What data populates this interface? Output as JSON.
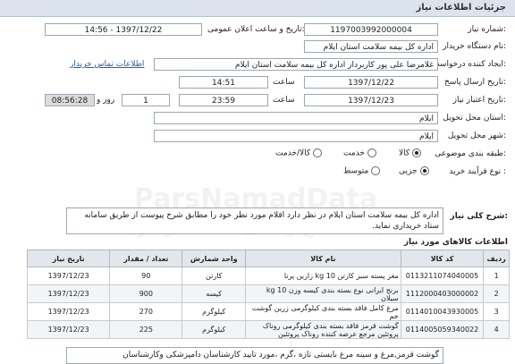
{
  "header": {
    "title": "جزئیات اطلاعات نیاز"
  },
  "form": {
    "need_number_label": "شماره نیاز:",
    "need_number": "1197003992000004",
    "announce_label": "تاریخ و ساعت اعلان عمومی:",
    "announce_value": "1397/12/22 - 14:56",
    "buyer_label": "نام دستگاه خریدار:",
    "buyer": "اداره کل بیمه سلامت استان ایلام",
    "creator_label": "ایجاد کننده درخواست:",
    "creator": "غلامرضا علی پور کاربرداز اداره کل بیمه سلامت استان ایلام",
    "contact_link": "اطلاعات تماس خریدار",
    "send_date_label": "تاریخ ارسال پاسخ:",
    "send_date": "1397/12/22",
    "send_time_label": "ساعت",
    "send_time": "14:51",
    "valid_label": "تاریخ اعتبار نیاز:",
    "valid_date": "1397/12/23",
    "valid_time_label": "ساعت",
    "valid_time": "23:59",
    "days": "1",
    "days_label": "روز و",
    "remaining": "08:56:28",
    "remaining_label": "ساعت باقی مانده",
    "province_label": "استان محل تحویل:",
    "province": "ایلام",
    "city_label": "شهر محل تحویل:",
    "city": "ایلام",
    "category_label": "طبقه بندی موضوعی:",
    "category_options": [
      "کالا",
      "خدمت",
      "کالا/خدمت"
    ],
    "category_selected": "کالا",
    "process_label": "نوع فرآیند خرید :",
    "process_options": [
      "جزیی",
      "متوسط"
    ],
    "process_selected": "جزیی"
  },
  "summary": {
    "label": "شرح کلی نیاز:",
    "text": "اداره کل بیمه سلامت استان ایلام در نظر دارد اقلام مورد نظر خود را مطابق شرح پیوست  از طریق سامانه ستاد خریداری نماید."
  },
  "items": {
    "section_title": "اطلاعات کالاهای مورد نیاز",
    "columns": [
      "ردیف",
      "کد کالا",
      "نام کالا",
      "واحد شمارش",
      "تعداد / مقدار",
      "تاریخ نیاز"
    ],
    "rows": [
      [
        "1",
        "0113211074040005",
        "مغز پسته سبز کارتن 10 kg زارین پرنا",
        "کارتن",
        "90",
        "1397/12/23"
      ],
      [
        "2",
        "1112000403000002",
        "برنج ایرانی نوع بسته بندی کیسه وزن 10 kg سیلان",
        "کیسه",
        "900",
        "1397/12/23"
      ],
      [
        "3",
        "0114010043930005",
        "مرغ کامل فاقد بسته بندی کیلوگرمی زرین گوشت جم",
        "کیلوگرم",
        "270",
        "1397/12/23"
      ],
      [
        "4",
        "0114005059340022",
        "گوشت قرمز فاقد بسته بندی کیلوگرمی روناک پروتئین مرجع عرضه کننده روناک پروتئین",
        "کیلوگرم",
        "225",
        "1397/12/23"
      ]
    ]
  },
  "buyer_notes": {
    "text": "گوشت قرمز,مرغ و سینه مرغ بایستی تازه ،گرم ،مورد تایید کارشناسان دامپزشکی وکارشناسان"
  },
  "watermark": {
    "line1": "ParsNamadData",
    "line2": "پایگاه اطلاع رسانی مناقصه و مزایده"
  },
  "colors": {
    "header_bg": "#dce3ec",
    "link": "#1f5fb3",
    "remaining_bg": "#dcdcdc"
  }
}
